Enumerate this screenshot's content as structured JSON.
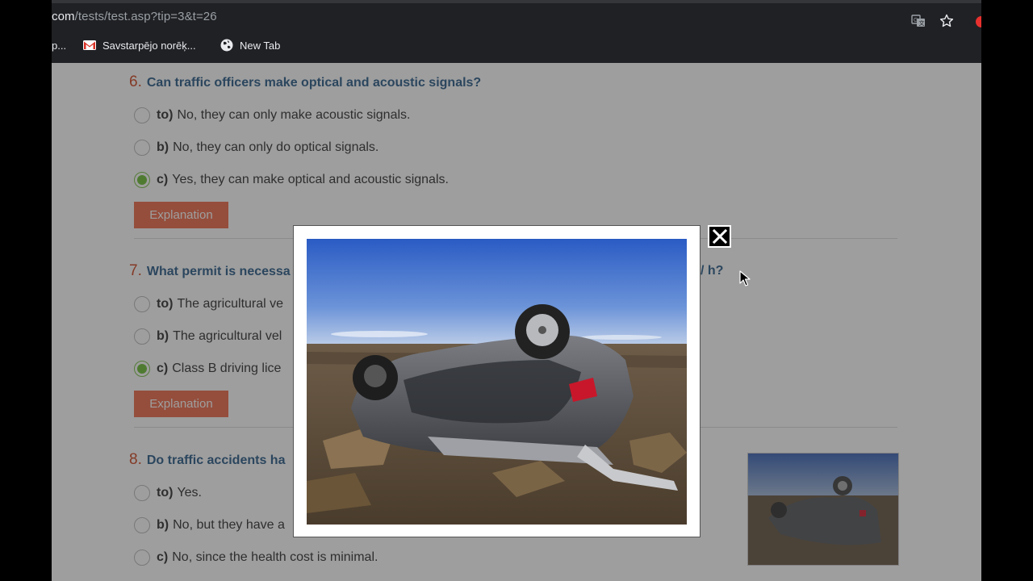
{
  "browser": {
    "url_host": "com",
    "url_path": "/tests/test.asp?tip=3&t=26",
    "translate_icon": "translate-icon",
    "star_icon": "star-icon",
    "bookmarks": [
      {
        "label": "p...",
        "icon": "none"
      },
      {
        "label": "Savstarpējo norēķ...",
        "icon": "gmail-icon"
      },
      {
        "label": "New Tab",
        "icon": "globe-icon"
      }
    ]
  },
  "questions": [
    {
      "number": "6.",
      "title": "Can traffic officers make optical and acoustic signals?",
      "options": [
        {
          "letter": "to)",
          "text": "No, they can only make acoustic signals.",
          "checked": false
        },
        {
          "letter": "b)",
          "text": "No, they can only do optical signals.",
          "checked": false
        },
        {
          "letter": "c)",
          "text": "Yes, they can make optical and acoustic signals.",
          "checked": true
        }
      ],
      "explanation_label": "Explanation"
    },
    {
      "number": "7.",
      "title_left": "What permit is necessa",
      "title_right": "/ h?",
      "options": [
        {
          "letter": "to)",
          "text": "The agricultural ve",
          "checked": false
        },
        {
          "letter": "b)",
          "text": "The agricultural vel",
          "checked": false
        },
        {
          "letter": "c)",
          "text": "Class B driving lice",
          "checked": true
        }
      ],
      "explanation_label": "Explanation"
    },
    {
      "number": "8.",
      "title": "Do traffic accidents ha",
      "options": [
        {
          "letter": "to)",
          "text": "Yes.",
          "checked": false
        },
        {
          "letter": "b)",
          "text": "No, but they have a",
          "checked": false
        },
        {
          "letter": "c)",
          "text": "No, since the health cost is minimal.",
          "checked": false
        }
      ]
    }
  ],
  "modal": {
    "image_subject": "overturned grey car on rocky ground",
    "close_icon": "close-icon"
  },
  "colors": {
    "question_title": "#2f5f8a",
    "question_number": "#d04a26",
    "explanation_button": "#ee6d4e",
    "radio_checked": "#6fbf3a"
  }
}
